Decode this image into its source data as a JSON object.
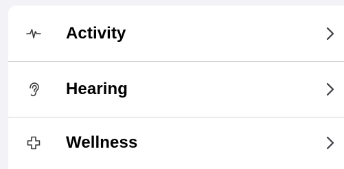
{
  "list": {
    "items": [
      {
        "label": "Activity",
        "icon": "activity-pulse-icon"
      },
      {
        "label": "Hearing",
        "icon": "ear-icon"
      },
      {
        "label": "Wellness",
        "icon": "wellness-cross-icon"
      }
    ]
  },
  "colors": {
    "background": "#f2f2f7",
    "card": "#ffffff",
    "separator": "#d1d1d6",
    "text": "#000000",
    "icon": "#3a3a3c",
    "chevron": "#3c3c43"
  }
}
